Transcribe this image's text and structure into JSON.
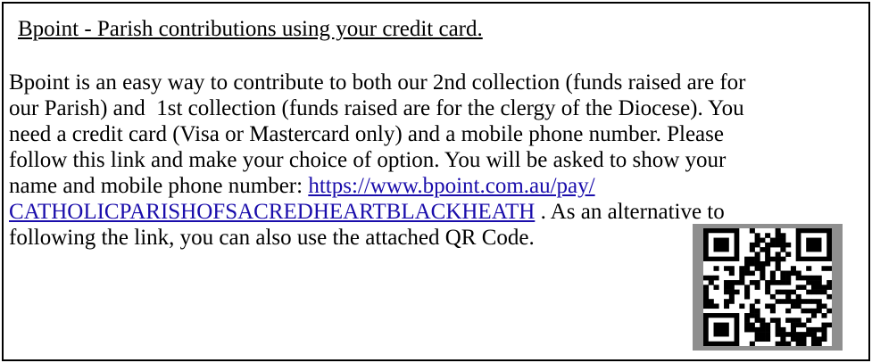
{
  "notice": {
    "title": "Bpoint - Parish contributions using your credit card.",
    "lines": {
      "l1": "Bpoint is an easy way to contribute to both our 2nd collection (funds raised are for",
      "l2": "our Parish) and  1st collection (funds raised are for the clergy of the Diocese). You",
      "l3": "need a credit card (Visa or Mastercard only) and a mobile phone number. Please",
      "l4": "follow this link and make your choice of option. You will be asked to show your",
      "l5_before_link": "name and mobile phone number: ",
      "link_part1": "https://www.bpoint.com.au/pay/",
      "link_part2": "CATHOLICPARISHOFSACREDHEARTBLACKHEATH",
      "l6_after_link": " . As an alternative to",
      "l7": "following the link, you can also use the attached QR Code."
    },
    "qr_code": {
      "icon": "qr-code-icon",
      "frame_color": "#8f8f8f",
      "module_color": "#000000",
      "background_color": "#ffffff"
    }
  }
}
